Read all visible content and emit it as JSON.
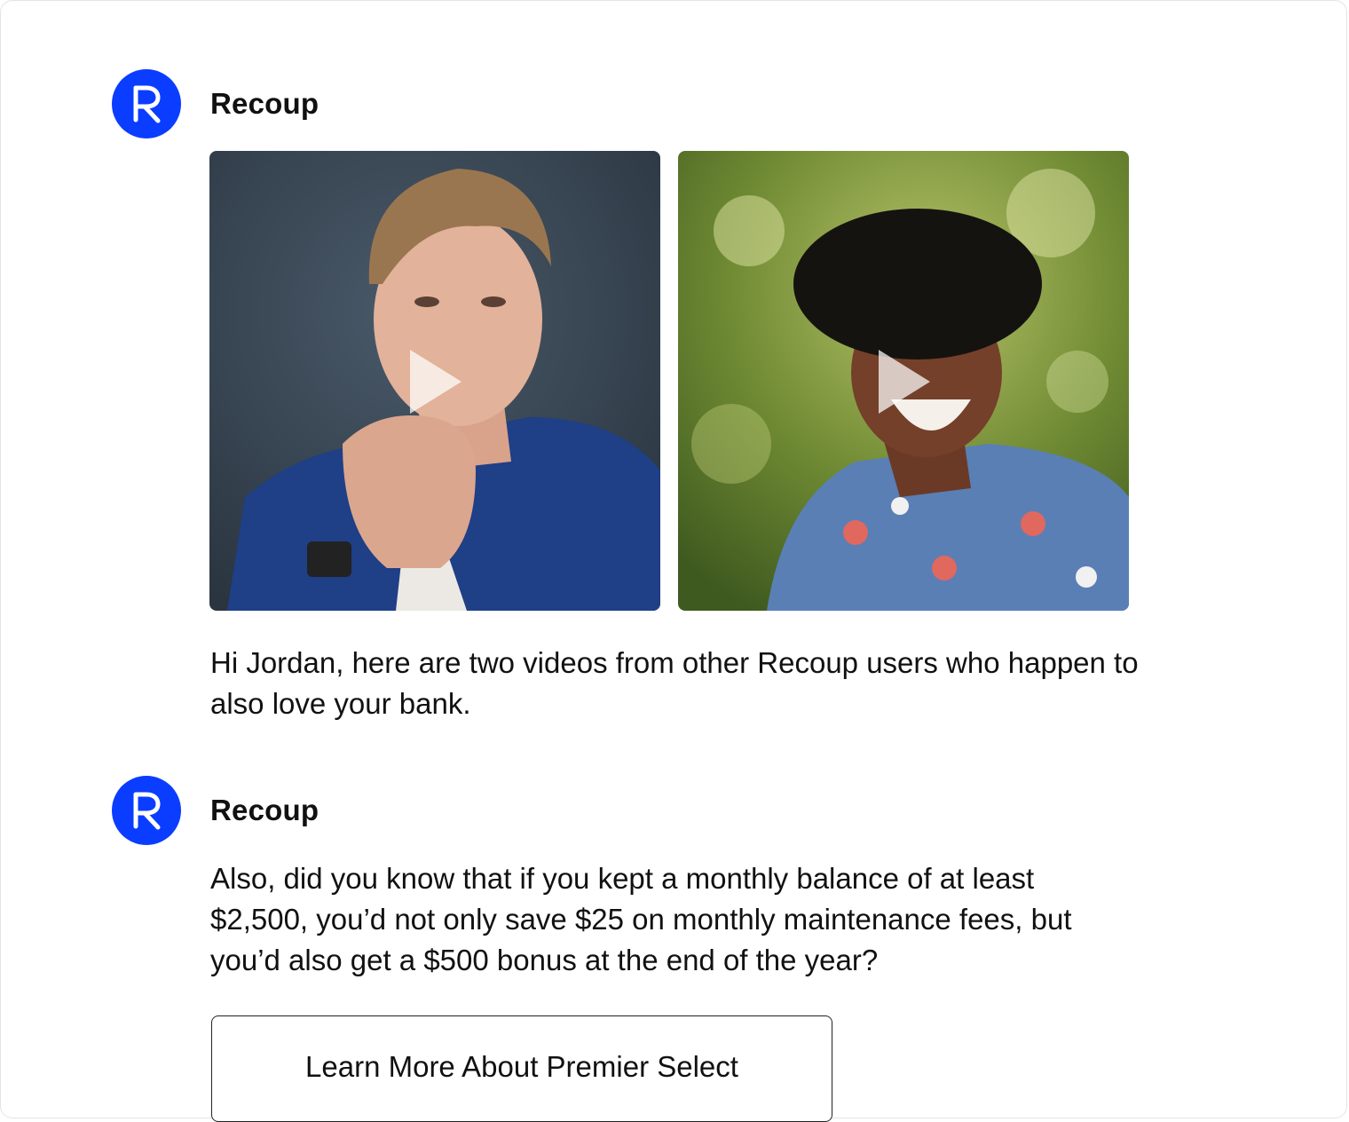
{
  "messages": [
    {
      "sender": "Recoup",
      "avatar_letter": "R",
      "videos": [
        {
          "description": "young man in blue blazer",
          "icon": "play-icon"
        },
        {
          "description": "woman laughing in floral top",
          "icon": "play-icon"
        }
      ],
      "text": "Hi Jordan, here are two videos from other Recoup users who happen to also love your bank."
    },
    {
      "sender": "Recoup",
      "avatar_letter": "R",
      "text": "Also, did you know that if you kept a monthly balance of at least $2,500, you’d not only save $25 on monthly maintenance fees, but you’d also get a $500 bonus at the end of the year?",
      "button_label": "Learn More About Premier Select"
    }
  ],
  "colors": {
    "brand": "#0a3dff",
    "text": "#111111",
    "background": "#ffffff"
  }
}
